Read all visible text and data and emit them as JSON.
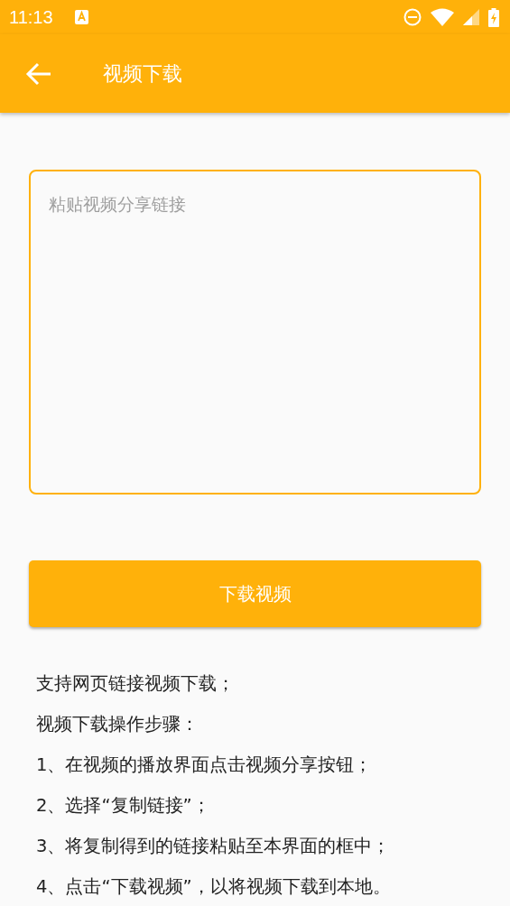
{
  "status_bar": {
    "time": "11:13"
  },
  "app_bar": {
    "title": "视频下载"
  },
  "link_field": {
    "placeholder": "粘贴视频分享链接"
  },
  "download_button": {
    "label": "下载视频"
  },
  "instructions": [
    "支持网页链接视频下载；",
    "视频下载操作步骤：",
    "1、在视频的播放界面点击视频分享按钮；",
    "2、选择“复制链接”；",
    "3、将复制得到的链接粘贴至本界面的框中；",
    "4、点击“下载视频”，以将视频下载到本地。"
  ]
}
